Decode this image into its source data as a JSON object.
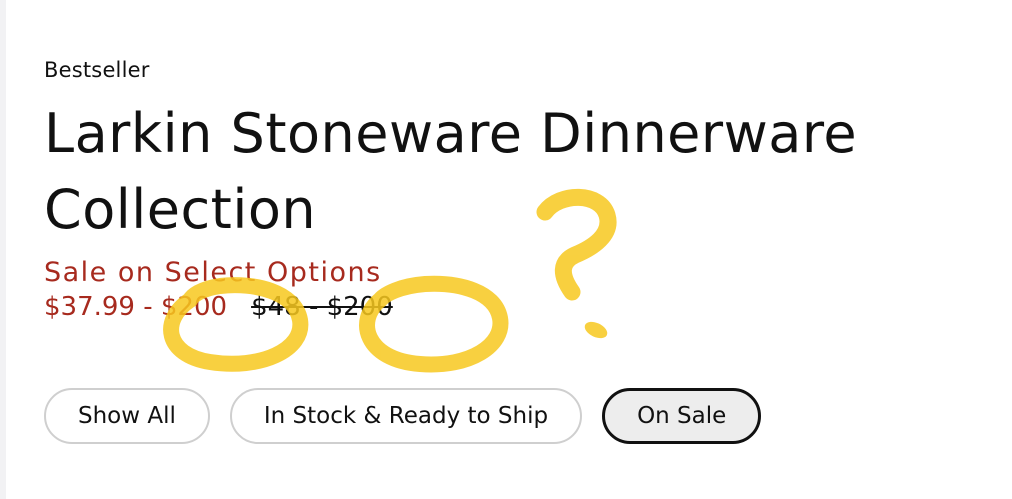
{
  "product": {
    "badge": "Bestseller",
    "title": "Larkin Stoneware Dinnerware Collection",
    "sale_label": "Sale on Select Options",
    "price_current": "$37.99 - $200",
    "price_original": "$48 - $200"
  },
  "filters": [
    {
      "label": "Show All",
      "selected": false
    },
    {
      "label": "In Stock & Ready to Ship",
      "selected": false
    },
    {
      "label": "On Sale",
      "selected": true
    }
  ],
  "colors": {
    "sale_red": "#a72a1e",
    "annotation_yellow": "#f7c81e",
    "chip_border": "#cfcfcf",
    "chip_selected_border": "#111111",
    "chip_selected_bg": "#ededed"
  }
}
